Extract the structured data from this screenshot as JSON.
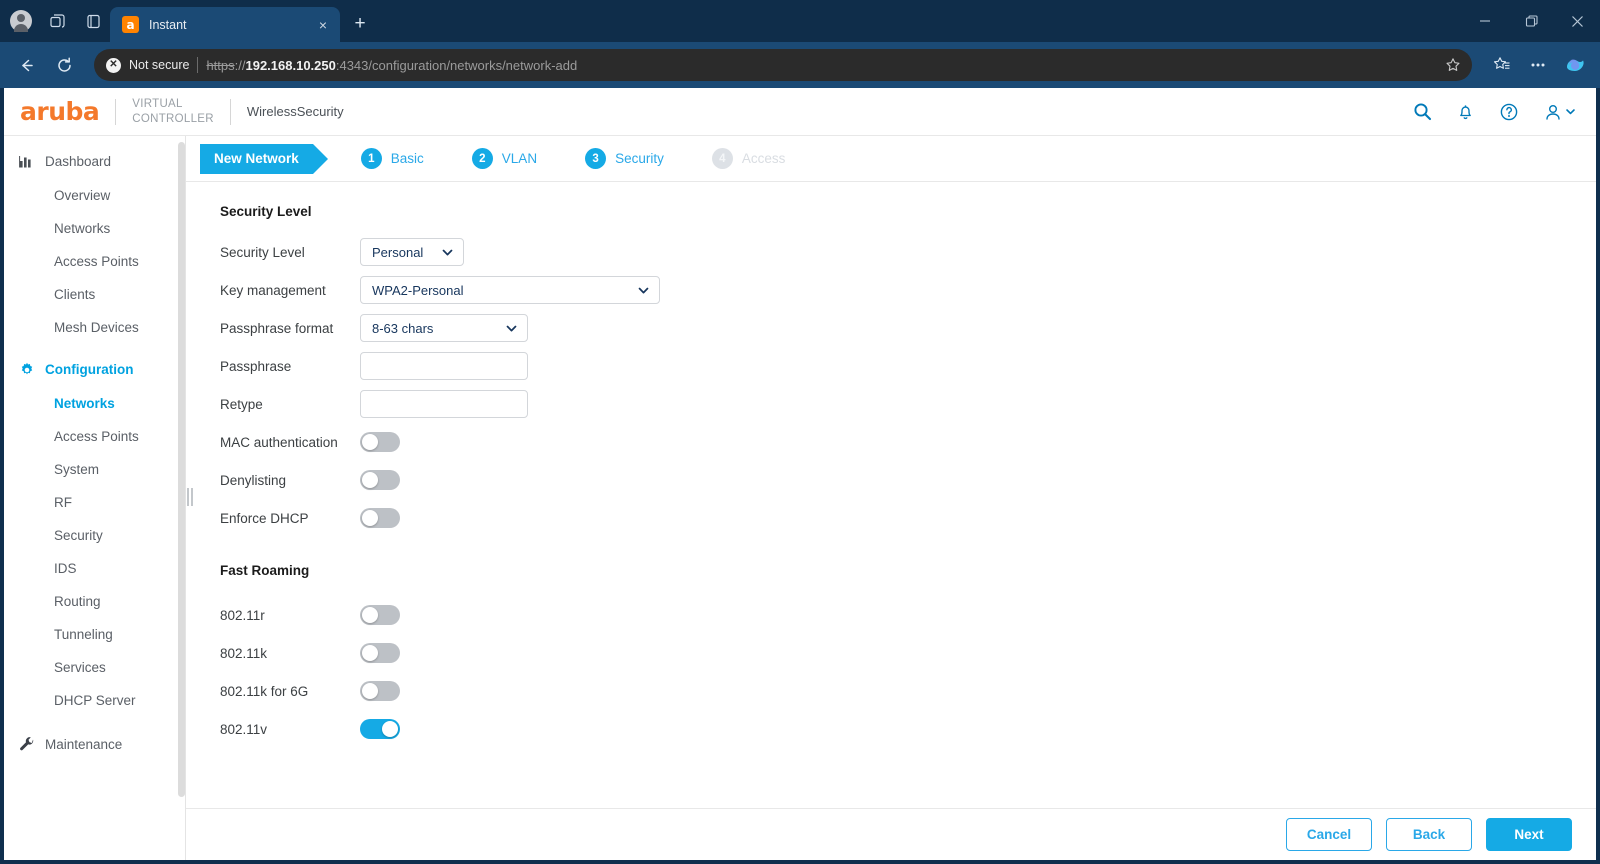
{
  "browser": {
    "tab": {
      "title": "Instant",
      "favicon": "aruba-icon",
      "close_label": "×"
    },
    "newtab_label": "+",
    "titlebar_icons": [
      "profile-icon",
      "split-screen-icon",
      "tab-actions-icon"
    ],
    "window_controls": [
      "minimize-icon",
      "restore-icon",
      "close-icon"
    ],
    "nav": {
      "back_label": "←",
      "reload_label": "↻"
    },
    "url": {
      "security_label": "Not secure",
      "security_icon": "not-secure-icon",
      "scheme": "https",
      "scheme_suffix": "://",
      "host": "192.168.10.250",
      "rest": ":4343/configuration/networks/network-add"
    },
    "toolbar_icons": [
      "favorites-star-icon",
      "collections-icon",
      "settings-more-icon",
      "copilot-icon"
    ]
  },
  "header": {
    "logo": "aruba",
    "virtual_line1": "VIRTUAL",
    "virtual_line2": "CONTROLLER",
    "app_title": "WirelessSecurity",
    "icons": [
      "search-icon",
      "notification-bell-icon",
      "help-icon",
      "user-account-icon"
    ]
  },
  "sidebar": {
    "groups": [
      {
        "label": "Dashboard",
        "icon": "bar-chart-icon",
        "active": false,
        "items": [
          {
            "label": "Overview",
            "active": false
          },
          {
            "label": "Networks",
            "active": false
          },
          {
            "label": "Access Points",
            "active": false
          },
          {
            "label": "Clients",
            "active": false
          },
          {
            "label": "Mesh Devices",
            "active": false
          }
        ]
      },
      {
        "label": "Configuration",
        "icon": "gear-icon",
        "active": true,
        "items": [
          {
            "label": "Networks",
            "active": true
          },
          {
            "label": "Access Points",
            "active": false
          },
          {
            "label": "System",
            "active": false
          },
          {
            "label": "RF",
            "active": false
          },
          {
            "label": "Security",
            "active": false
          },
          {
            "label": "IDS",
            "active": false
          },
          {
            "label": "Routing",
            "active": false
          },
          {
            "label": "Tunneling",
            "active": false
          },
          {
            "label": "Services",
            "active": false
          },
          {
            "label": "DHCP Server",
            "active": false
          }
        ]
      },
      {
        "label": "Maintenance",
        "icon": "wrench-icon",
        "active": false,
        "items": []
      }
    ]
  },
  "wizard": {
    "tab_label": "New Network",
    "steps": [
      {
        "num": "1",
        "label": "Basic",
        "disabled": false
      },
      {
        "num": "2",
        "label": "VLAN",
        "disabled": false
      },
      {
        "num": "3",
        "label": "Security",
        "disabled": false
      },
      {
        "num": "4",
        "label": "Access",
        "disabled": true
      }
    ]
  },
  "form": {
    "section_security_level": "Security Level",
    "section_fast_roaming": "Fast Roaming",
    "fields": {
      "security_level": {
        "label": "Security Level",
        "value": "Personal"
      },
      "key_management": {
        "label": "Key management",
        "value": "WPA2-Personal"
      },
      "passphrase_format": {
        "label": "Passphrase format",
        "value": "8-63 chars"
      },
      "passphrase": {
        "label": "Passphrase",
        "value": "",
        "placeholder": ""
      },
      "retype": {
        "label": "Retype",
        "value": "",
        "placeholder": ""
      },
      "mac_authentication": {
        "label": "MAC authentication",
        "on": false
      },
      "denylisting": {
        "label": "Denylisting",
        "on": false
      },
      "enforce_dhcp": {
        "label": "Enforce DHCP",
        "on": false
      },
      "dot11r": {
        "label": "802.11r",
        "on": false
      },
      "dot11k": {
        "label": "802.11k",
        "on": false
      },
      "dot11k_6g": {
        "label": "802.11k for 6G",
        "on": false
      },
      "dot11v": {
        "label": "802.11v",
        "on": true
      }
    }
  },
  "footer": {
    "cancel_label": "Cancel",
    "back_label": "Back",
    "next_label": "Next"
  },
  "colors": {
    "brand_orange": "#f4792b",
    "accent_blue": "#15aae5",
    "link_blue": "#2aa8e8",
    "chrome_dark": "#102f4e",
    "toggle_off": "#bdc1c6"
  }
}
